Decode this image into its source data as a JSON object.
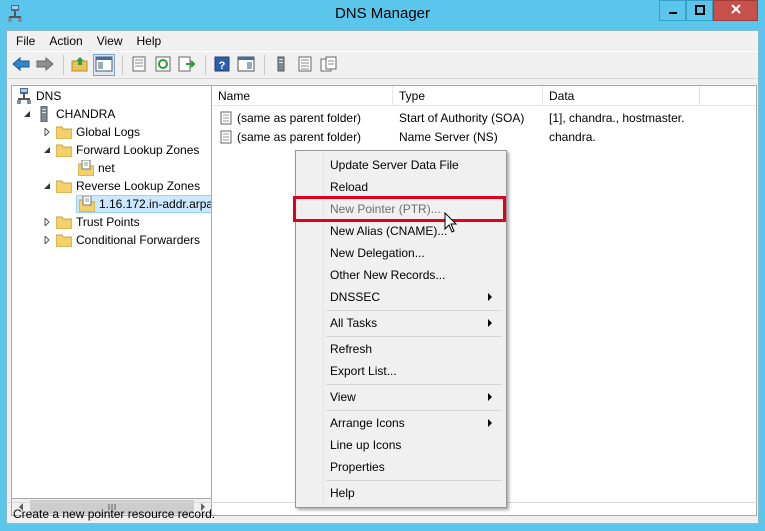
{
  "window": {
    "title": "DNS Manager",
    "icons": [
      "dns-app-icon",
      "minimize-icon",
      "maximize-icon",
      "close-icon"
    ]
  },
  "menubar": {
    "items": [
      "File",
      "Action",
      "View",
      "Help"
    ]
  },
  "toolbar": {
    "icons": [
      "back-arrow-icon",
      "forward-arrow-icon",
      "up-folder-icon",
      "show-hide-tree-icon",
      "properties-icon",
      "refresh-icon",
      "export-icon",
      "help-icon",
      "show-pane-icon",
      "server-icon",
      "zone-list-icon",
      "copy-icon"
    ]
  },
  "tree": {
    "items": [
      {
        "label": "DNS",
        "icon": "dns-icon",
        "expander": "none"
      },
      {
        "label": "CHANDRA",
        "icon": "server-icon",
        "expander": "expanded"
      },
      {
        "label": "Global Logs",
        "icon": "folder-icon",
        "expander": "collapsed"
      },
      {
        "label": "Forward Lookup Zones",
        "icon": "folder-icon",
        "expander": "expanded"
      },
      {
        "label": "net",
        "icon": "zone-icon",
        "expander": "none"
      },
      {
        "label": "Reverse Lookup Zones",
        "icon": "folder-icon",
        "expander": "expanded"
      },
      {
        "label": "1.16.172.in-addr.arpa",
        "icon": "zone-icon",
        "expander": "none",
        "selected": true
      },
      {
        "label": "Trust Points",
        "icon": "folder-icon",
        "expander": "collapsed"
      },
      {
        "label": "Conditional Forwarders",
        "icon": "folder-icon",
        "expander": "collapsed"
      }
    ]
  },
  "list": {
    "columns": [
      "Name",
      "Type",
      "Data"
    ],
    "rows": [
      {
        "name": "(same as parent folder)",
        "type": "Start of Authority (SOA)",
        "data": "[1], chandra., hostmaster."
      },
      {
        "name": "(same as parent folder)",
        "type": "Name Server (NS)",
        "data": "chandra."
      }
    ]
  },
  "context_menu": {
    "items": [
      {
        "label": "Update Server Data File"
      },
      {
        "label": "Reload"
      },
      {
        "label": "New Pointer (PTR)...",
        "highlighted": true
      },
      {
        "label": "New Alias (CNAME)..."
      },
      {
        "label": "New Delegation..."
      },
      {
        "label": "Other New Records..."
      },
      {
        "label": "DNSSEC",
        "submenu": true
      },
      {
        "label": "All Tasks",
        "submenu": true
      },
      {
        "label": "Refresh"
      },
      {
        "label": "Export List..."
      },
      {
        "label": "View",
        "submenu": true
      },
      {
        "label": "Arrange Icons",
        "submenu": true
      },
      {
        "label": "Line up Icons"
      },
      {
        "label": "Properties"
      },
      {
        "label": "Help"
      }
    ]
  },
  "status": {
    "text": "Create a new pointer resource record."
  },
  "colors": {
    "title_bar": "#5bc6ec",
    "close_button": "#c7504b",
    "highlight_box": "#e0001b",
    "tree_selection": "#cce8ff"
  }
}
